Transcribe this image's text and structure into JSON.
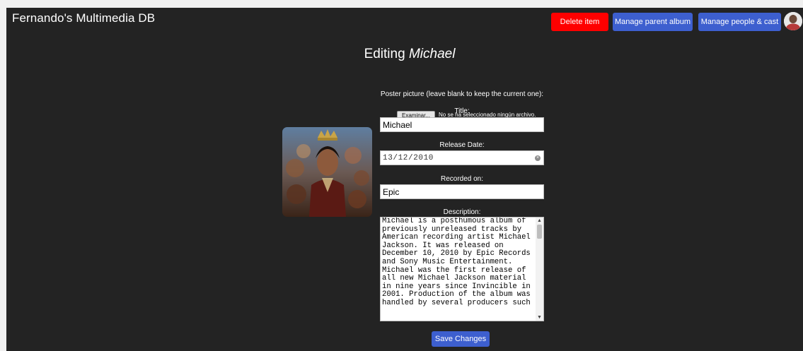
{
  "header": {
    "brand": "Fernando's Multimedia DB",
    "delete_label": "Delete item",
    "parent_album_label": "Manage parent album",
    "people_cast_label": "Manage people & cast"
  },
  "page": {
    "title_prefix": "Editing",
    "title_name": "Michael"
  },
  "form": {
    "poster_label": "Poster picture (leave blank to keep the current one):",
    "file_button_label": "Examinar...",
    "file_status": "No se ha seleccionado ningún archivo.",
    "title_label": "Title:",
    "title_value": "Michael",
    "release_label": "Release Date:",
    "release_value": "13/12/2010",
    "recorded_label": "Recorded on:",
    "recorded_value": "Epic",
    "description_label": "Description:",
    "description_value": "Michael is a posthumous album of\npreviously unreleased tracks by\nAmerican recording artist Michael\nJackson. It was released on\nDecember 10, 2010 by Epic Records\nand Sony Music Entertainment.\nMichael was the first release of\nall new Michael Jackson material\nin nine years since Invincible in\n2001. Production of the album was\nhandled by several producers such",
    "save_label": "Save Changes"
  },
  "icons": {
    "avatar": "user-avatar",
    "clear": "clear-icon",
    "scroll_up": "scroll-up-arrow",
    "scroll_down": "scroll-down-arrow"
  },
  "colors": {
    "background": "#232323",
    "danger": "#ff0000",
    "primary": "#3d5fcf"
  }
}
